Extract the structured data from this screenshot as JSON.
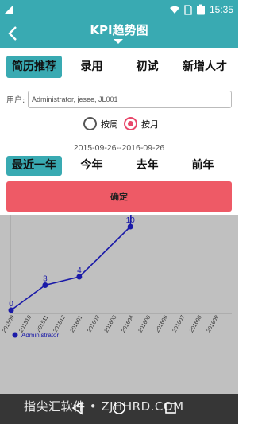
{
  "status_bar": {
    "time": "15:35",
    "icons": [
      "signal-icon",
      "wifi-icon",
      "sim-icon",
      "battery-icon"
    ]
  },
  "app_bar": {
    "title": "KPI趋势图",
    "icons": [
      "back-arrow-icon",
      "dropdown-caret-icon"
    ]
  },
  "tabs": [
    {
      "label": "简历推荐",
      "active": true
    },
    {
      "label": "录用",
      "active": false
    },
    {
      "label": "初试",
      "active": false
    },
    {
      "label": "新增人才",
      "active": false
    }
  ],
  "user_filter": {
    "label": "用户:",
    "value": "Administrator, jesee, JL001"
  },
  "granularity": [
    {
      "label": "按周",
      "checked": false
    },
    {
      "label": "按月",
      "checked": true
    }
  ],
  "date_range": "2015-09-26--2016-09-26",
  "periods": [
    {
      "label": "最近一年",
      "active": true
    },
    {
      "label": "今年",
      "active": false
    },
    {
      "label": "去年",
      "active": false
    },
    {
      "label": "前年",
      "active": false
    }
  ],
  "confirm_label": "确定",
  "chart_data": {
    "type": "line",
    "categories": [
      "201509",
      "201510",
      "201511",
      "201512",
      "201601",
      "201602",
      "201603",
      "201604",
      "201605",
      "201606",
      "201607",
      "201608",
      "201609"
    ],
    "series": [
      {
        "name": "Administrator",
        "color": "#1a1aa8",
        "values": [
          0,
          null,
          3,
          null,
          4,
          null,
          null,
          10,
          55,
          19,
          null,
          null,
          null
        ],
        "labels": [
          "0",
          "",
          "3",
          "",
          "4",
          "",
          "",
          "10",
          "",
          "19",
          "",
          "",
          ""
        ]
      }
    ],
    "legend": "bottom-left",
    "background": "#c0c0c0"
  },
  "nav_bar": {
    "watermark": "指尖汇软件 • ZJHHRD.COM",
    "icons": [
      "back-triangle-icon",
      "home-circle-icon",
      "recent-square-icon"
    ]
  },
  "colors": {
    "primary": "#39aab2",
    "confirm": "#ee5a66",
    "radio_checked": "#e8476a",
    "series": "#1a1aa8"
  }
}
